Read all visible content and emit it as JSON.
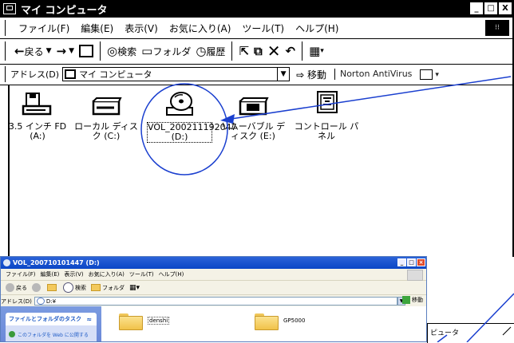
{
  "main_window": {
    "title": "マイ コンピュータ",
    "caption_buttons": {
      "minimize": "_",
      "maximize": "□",
      "close": "X"
    },
    "menu": [
      "ファイル(F)",
      "編集(E)",
      "表示(V)",
      "お気に入り(A)",
      "ツール(T)",
      "ヘルプ(H)"
    ],
    "toolbar": {
      "back": "戻る",
      "search": "検索",
      "folders": "フォルダ",
      "history": "履歴"
    },
    "address": {
      "label": "アドレス(D)",
      "value": "マイ コンピュータ",
      "go": "移動",
      "norton": "Norton AntiVirus"
    },
    "drives": [
      {
        "label": "3.5 インチ FD (A:)",
        "icon": "floppy-drive-icon"
      },
      {
        "label": "ローカル ディスク (C:)",
        "icon": "hard-disk-icon"
      },
      {
        "label": "VOL_200211192047 (D:)",
        "icon": "cd-drive-icon",
        "selected": true
      },
      {
        "label": "リムーバブル ディスク (E:)",
        "icon": "removable-disk-icon"
      },
      {
        "label": "コントロール パネル",
        "icon": "control-panel-icon"
      }
    ]
  },
  "second_window": {
    "title": "VOL_200710101447 (D:)",
    "menu": [
      "ファイル(F)",
      "編集(E)",
      "表示(V)",
      "お気に入り(A)",
      "ツール(T)",
      "ヘルプ(H)"
    ],
    "toolbar": {
      "back": "戻る",
      "search": "検索",
      "folders": "フォルダ"
    },
    "address": {
      "label": "アドレス(D)",
      "value": "D:¥",
      "go": "移動"
    },
    "task_pane": {
      "header": "ファイルとフォルダのタスク",
      "item": "このフォルダを Web に公開する"
    },
    "folders": [
      "denshi",
      "GP5000"
    ]
  },
  "third_window_fragment": {
    "title": "ピュータ"
  },
  "annotation": {
    "color": "#1a3fcf"
  }
}
